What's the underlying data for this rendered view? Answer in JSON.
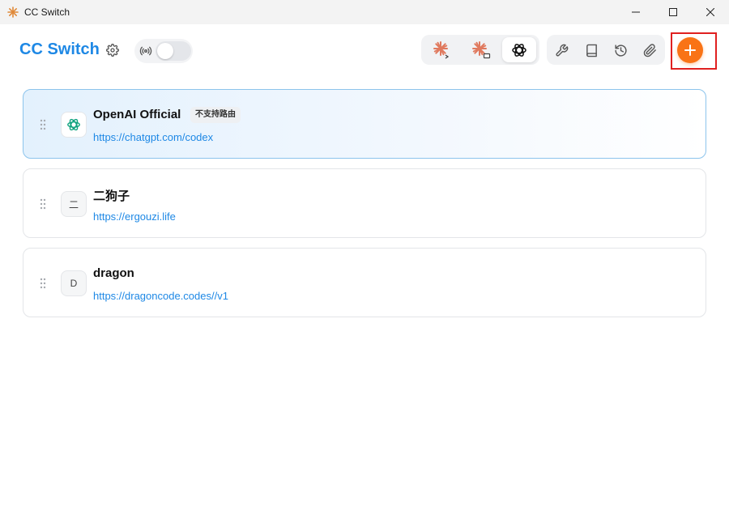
{
  "window": {
    "title": "CC Switch",
    "controls": [
      "minimize",
      "maximize",
      "close"
    ]
  },
  "header": {
    "brand": "CC Switch",
    "proxy_toggle_on": false,
    "app_tabs": [
      {
        "name": "claude",
        "icon": "claude-code-icon",
        "active": false
      },
      {
        "name": "claude-desktop",
        "icon": "claude-desktop-icon",
        "active": false
      },
      {
        "name": "codex",
        "icon": "openai-icon",
        "active": true
      }
    ],
    "tools": [
      "wrench-icon",
      "book-icon",
      "history-icon",
      "paperclip-icon"
    ],
    "add_button": "plus-icon"
  },
  "providers": [
    {
      "name": "OpenAI Official",
      "url": "https://chatgpt.com/codex",
      "badge": "不支持路由",
      "icon": "openai-icon",
      "active": true
    },
    {
      "name": "二狗子",
      "url": "https://ergouzi.life",
      "icon_letter": "二",
      "active": false
    },
    {
      "name": "dragon",
      "url": "https://dragoncode.codes//v1",
      "icon_letter": "D",
      "active": false
    }
  ],
  "colors": {
    "brand": "#1e88e5",
    "accent": "#f97316",
    "link": "#1e88e5",
    "highlight": "#e02020"
  }
}
